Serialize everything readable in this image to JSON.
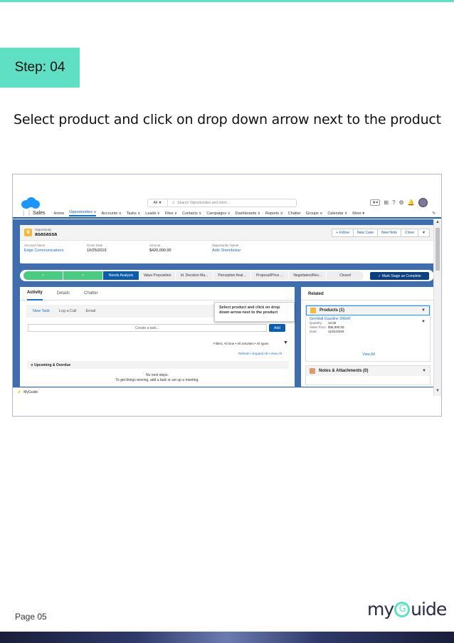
{
  "step_label": "Step: 04",
  "instruction": "Select product and click on drop down arrow next to the product",
  "screenshot": {
    "search": {
      "scope": "All ▼",
      "placeholder": "Search Opportunities and more..."
    },
    "app_name": "Sales",
    "nav_items": [
      "Home",
      "Opportunities ∨",
      "Accounts ∨",
      "Tasks ∨",
      "Leads ∨",
      "Files ∨",
      "Contacts ∨",
      "Campaigns ∨",
      "Dashboards ∨",
      "Reports ∨",
      "Chatter",
      "Groups ∨",
      "Calendar ∨",
      "More ▾"
    ],
    "opportunity": {
      "type_label": "Opportunity",
      "name": "asasassa",
      "buttons": [
        "+ Follow",
        "New Case",
        "New Note",
        "Clone",
        "▼"
      ],
      "fields": [
        {
          "label": "Account Name",
          "value": "Edge Communications"
        },
        {
          "label": "Close Date",
          "value": "10/25/2019"
        },
        {
          "label": "Amount",
          "value": "$420,000.00"
        },
        {
          "label": "Opportunity Owner",
          "value": "Aditi Shembekar"
        }
      ]
    },
    "path_stages": [
      "✓",
      "✓",
      "Needs Analysis",
      "Value Proposition",
      "Id. Decision Ma...",
      "Perception Anal...",
      "Proposal/Price ...",
      "Negotiation/Rev...",
      "Closed"
    ],
    "mark_stage_button": "✓ Mark Stage as Complete",
    "activity": {
      "tabs": [
        "Activity",
        "Details",
        "Chatter"
      ],
      "subtabs": [
        "New Task",
        "Log a Call",
        "Email"
      ],
      "task_placeholder": "Create a task...",
      "add_button": "Add",
      "filters": "Filters: All time • All activities • All types",
      "refresh": "Refresh • Expand All • View All",
      "upcoming": "∨  Upcoming & Overdue",
      "no_steps_1": "No next steps.",
      "no_steps_2": "To get things moving, add a task or set up a meeting."
    },
    "related": {
      "title": "Related",
      "products_title": "Products (1)",
      "product_name": "GenWatt Gasoline 300kW",
      "product_fields": [
        {
          "k": "Quantity:",
          "v": "12.00"
        },
        {
          "k": "Sales Price:",
          "v": "$35,000.00"
        },
        {
          "k": "Date:",
          "v": "11/21/2019"
        }
      ],
      "view_all": "View All",
      "notes_title": "Notes & Attachments (0)"
    },
    "tooltip": "Select product and click on drop down arrow next to the product",
    "myguide_label": "MyGuide"
  },
  "page_number": "Page 05",
  "logo": {
    "pre": "my",
    "g": "G",
    "post": "uide"
  }
}
